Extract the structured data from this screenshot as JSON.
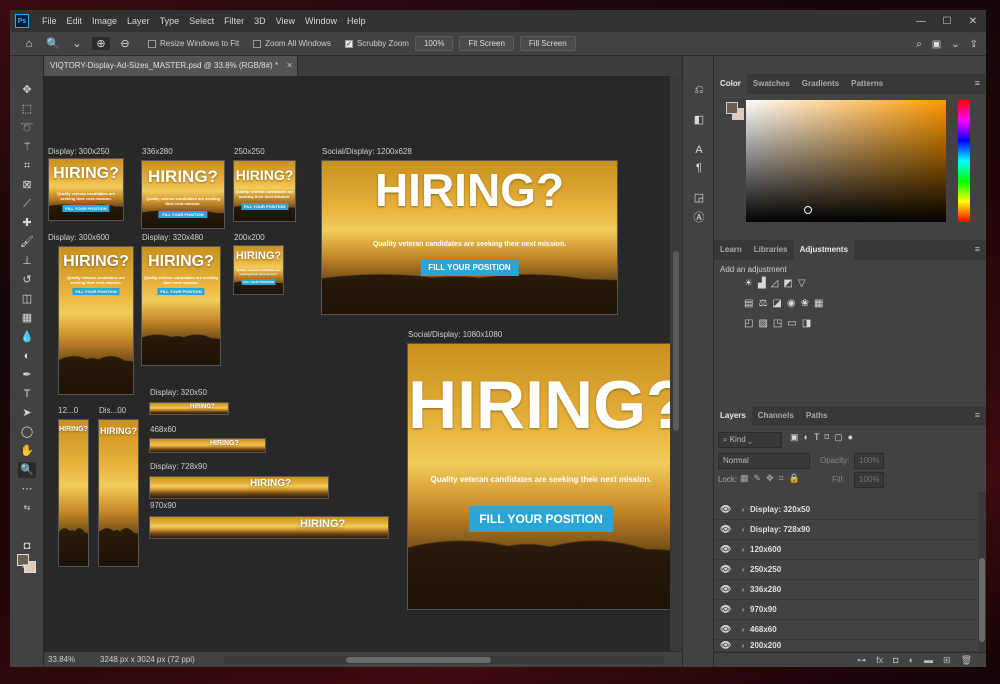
{
  "app": {
    "menu": [
      "File",
      "Edit",
      "Image",
      "Layer",
      "Type",
      "Select",
      "Filter",
      "3D",
      "View",
      "Window",
      "Help"
    ],
    "window_controls": [
      "—",
      "☐",
      "✕"
    ]
  },
  "options": {
    "resize_windows": "Resize Windows to Fit",
    "zoom_all": "Zoom All Windows",
    "scrubby": "Scrubby Zoom",
    "zoom_value": "100%",
    "fit_screen": "Fit Screen",
    "fill_screen": "Fill Screen"
  },
  "document": {
    "tab_title": "VIQTORY-Display-Ad-Sizes_MASTER.psd @ 33.8% (RGB/8#) *",
    "zoom": "33.84%",
    "dimensions": "3248 px x 3024 px (72 ppi)"
  },
  "ad_copy": {
    "headline": "HIRING?",
    "tagline": "Quality veteran candidates are seeking their next mission.",
    "cta": "FILL YOUR POSITION"
  },
  "artboards": {
    "a300x250": "Display: 300x250",
    "a336x280": "336x280",
    "a250x250": "250x250",
    "a1200x628": "Social/Display: 1200x628",
    "a300x600": "Display: 300x600",
    "a320x480": "Display: 320x480",
    "a200x200": "200x200",
    "a1080x1080": "Social/Display: 1080x1080",
    "a320x50": "Display: 320x50",
    "a468x60": "468x60",
    "a728x90": "Display: 728x90",
    "a970x90": "970x90",
    "a120": "12...0",
    "adis": "Dis...00"
  },
  "panels": {
    "color_tabs": [
      "Color",
      "Swatches",
      "Gradients",
      "Patterns"
    ],
    "adj_tabs": [
      "Learn",
      "Libraries",
      "Adjustments"
    ],
    "adj_title": "Add an adjustment",
    "layer_tabs": [
      "Layers",
      "Channels",
      "Paths"
    ],
    "kind": "Kind",
    "blend": "Normal",
    "opacity_label": "Opacity:",
    "opacity": "100%",
    "lock_label": "Lock:",
    "fill_label": "Fill:",
    "fill": "100%",
    "layers": [
      "Display: 320x50",
      "Display: 728x90",
      "120x600",
      "250x250",
      "336x280",
      "970x90",
      "468x60",
      "200x200"
    ]
  }
}
